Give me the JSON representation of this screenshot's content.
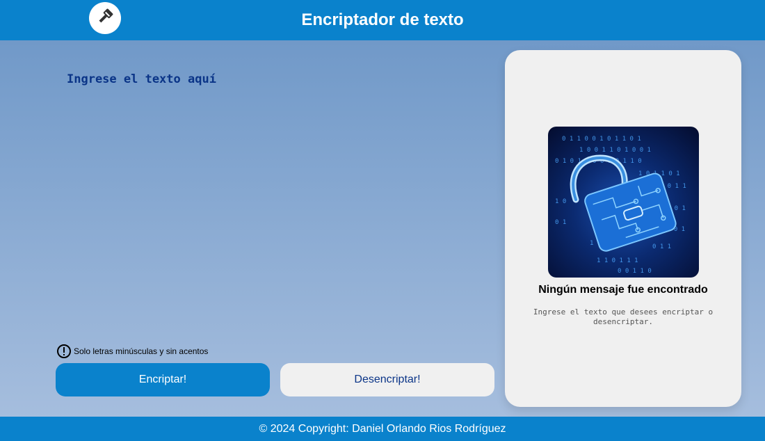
{
  "header": {
    "title": "Encriptador de texto",
    "logo_icon": "key-icon"
  },
  "input": {
    "placeholder": "Ingrese el texto aquí",
    "value": ""
  },
  "hint": {
    "icon": "exclamation-circle-icon",
    "text": "Solo letras minúsculas y sin acentos"
  },
  "buttons": {
    "encrypt_label": "Encriptar!",
    "decrypt_label": "Desencriptar!"
  },
  "output": {
    "image": "padlock-binary-icon",
    "title": "Ningún mensaje fue encontrado",
    "description": "Ingrese el texto que desees encriptar o desencriptar."
  },
  "footer": {
    "text": "© 2024 Copyright: Daniel Orlando Rios Rodríguez"
  },
  "colors": {
    "brand_blue": "#0a82cc",
    "text_dark_blue": "#0a3487",
    "panel_bg": "#f0f0f0"
  }
}
